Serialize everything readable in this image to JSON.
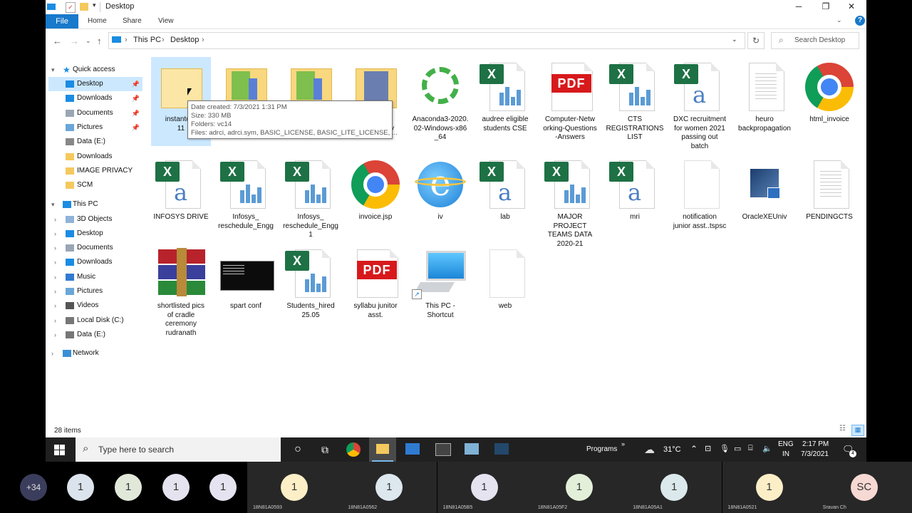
{
  "window": {
    "title": "Desktop",
    "ribbon_tabs": [
      "File",
      "Home",
      "Share",
      "View"
    ],
    "breadcrumb": [
      "This PC",
      "Desktop"
    ],
    "search_placeholder": "Search Desktop",
    "status_items": "28 items"
  },
  "nav": {
    "quick_access": "Quick access",
    "quick_items": [
      {
        "label": "Desktop",
        "pinned": true
      },
      {
        "label": "Downloads",
        "pinned": true
      },
      {
        "label": "Documents",
        "pinned": true
      },
      {
        "label": "Pictures",
        "pinned": true
      },
      {
        "label": "Data (E:)"
      },
      {
        "label": "Downloads"
      },
      {
        "label": "IMAGE PRIVACY"
      },
      {
        "label": "SCM"
      }
    ],
    "this_pc": "This PC",
    "pc_items": [
      "3D Objects",
      "Desktop",
      "Documents",
      "Downloads",
      "Music",
      "Pictures",
      "Videos",
      "Local Disk (C:)",
      "Data (E:)"
    ],
    "network": "Network"
  },
  "files": [
    {
      "name": "instantclie\n11",
      "icon": "folder"
    },
    {
      "name": "",
      "icon": "folder-doc"
    },
    {
      "name": "",
      "icon": "folder-doc"
    },
    {
      "name": "...ics\n...ceremony\nrudranath",
      "icon": "folder-photo"
    },
    {
      "name": "Anaconda3-2020.\n02-Windows-x86\n_64",
      "icon": "anaconda"
    },
    {
      "name": "audree eligible\nstudents CSE",
      "icon": "excel-chart"
    },
    {
      "name": "Computer-Netw\norking-Questions\n-Answers",
      "icon": "pdf"
    },
    {
      "name": "CTS\nREGISTRATIONS\nLIST",
      "icon": "excel-chart"
    },
    {
      "name": "DXC recruitment\nfor women 2021\npassing out\nbatch",
      "icon": "excel-a"
    },
    {
      "name": "heuro\nbackpropagation",
      "icon": "text-doc"
    },
    {
      "name": "html_invoice",
      "icon": "chrome"
    },
    {
      "name": "INFOSYS DRIVE",
      "icon": "excel-a"
    },
    {
      "name": "Infosys_\nreschedule_Engg",
      "icon": "excel-chart"
    },
    {
      "name": "Infosys_\nreschedule_Engg\n1",
      "icon": "excel-chart"
    },
    {
      "name": "invoice.jsp",
      "icon": "chrome"
    },
    {
      "name": "iv",
      "icon": "ie"
    },
    {
      "name": "lab",
      "icon": "excel-a"
    },
    {
      "name": "MAJOR PROJECT\nTEAMS DATA\n2020-21",
      "icon": "excel-chart"
    },
    {
      "name": "mri",
      "icon": "excel-a"
    },
    {
      "name": "notification\njunior asst..tspsc",
      "icon": "blank-doc"
    },
    {
      "name": "OracleXEUniv",
      "icon": "oracle"
    },
    {
      "name": "PENDINGCTS",
      "icon": "text-doc"
    },
    {
      "name": "shortlisted pics\nof cradle\nceremony\nrudranath",
      "icon": "winrar"
    },
    {
      "name": "spart conf",
      "icon": "terminal"
    },
    {
      "name": "Students_hired\n25.05",
      "icon": "excel-chart"
    },
    {
      "name": "syllabu junitor\nasst.",
      "icon": "pdf"
    },
    {
      "name": "This PC -\nShortcut",
      "icon": "computer"
    },
    {
      "name": "web",
      "icon": "blank-doc"
    }
  ],
  "tooltip": {
    "created": "Date created: 7/3/2021 1:31 PM",
    "size": "Size: 330 MB",
    "folders": "Folders: vc14",
    "files": "Files: adrci, adrci.sym, BASIC_LICENSE, BASIC_LITE_LICENSE, ..."
  },
  "taskbar": {
    "search_placeholder": "Type here to search",
    "programs": "Programs",
    "weather": "31°C",
    "lang": "ENG",
    "region": "IN",
    "time": "2:17 PM",
    "date": "7/3/2021",
    "notifications": "4"
  },
  "meet": {
    "overflow": "+34",
    "small_avatars": [
      "1",
      "1",
      "1",
      "1"
    ],
    "tiles": [
      {
        "avatar": "1",
        "caption": "18N81A0593",
        "color": "#fcefc7"
      },
      {
        "avatar": "1",
        "caption": "18N81A0562",
        "color": "#dde7ee"
      },
      {
        "avatar": "1",
        "caption": "18N81A05B5",
        "color": "#e6e3f0"
      },
      {
        "avatar": "1",
        "caption": "18N81A05F2",
        "color": "#e3efd9"
      },
      {
        "avatar": "1",
        "caption": "18N81A05A1",
        "color": "#dbe9ec"
      },
      {
        "avatar": "1",
        "caption": "18N81A0521",
        "color": "#fcefc7"
      },
      {
        "avatar": "SC",
        "caption": "Sravan Ch",
        "color": "#f7d9d4"
      }
    ]
  },
  "colors": {
    "accent": "#1979ca",
    "selection": "#cce8ff",
    "taskbar": "#202020"
  }
}
